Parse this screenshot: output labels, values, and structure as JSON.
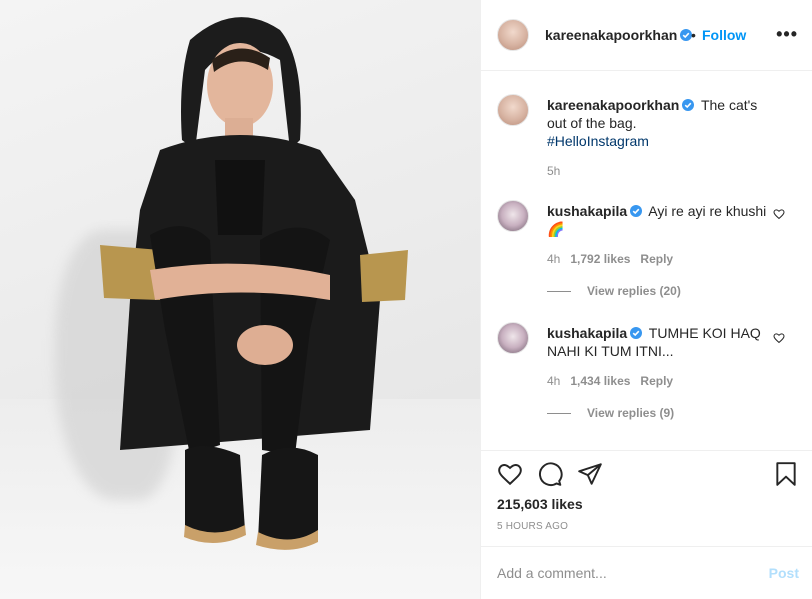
{
  "post": {
    "author": "kareenakapoorkhan",
    "separator": "•",
    "follow_label": "Follow",
    "more_label": "•••",
    "caption": "The cat's out of the bag.",
    "hashtag": "#HelloInstagram",
    "caption_age": "5h",
    "likes": "215,603 likes",
    "posted_ago": "5 HOURS AGO"
  },
  "comments": [
    {
      "user": "kushakapila",
      "text": "Ayi re ayi re khushi 🌈",
      "age": "4h",
      "likes": "1,792 likes",
      "reply_label": "Reply",
      "view_replies": "View replies (20)"
    },
    {
      "user": "kushakapila",
      "text": "TUMHE KOI HAQ NAHI KI TUM ITNI...",
      "age": "4h",
      "likes": "1,434 likes",
      "reply_label": "Reply",
      "view_replies": "View replies (9)"
    }
  ],
  "add_comment": {
    "placeholder": "Add a comment...",
    "post_label": "Post"
  },
  "icons": {
    "verified": "verified-badge-icon",
    "like": "heart-icon",
    "comment": "comment-bubble-icon",
    "share": "paper-plane-icon",
    "save": "bookmark-icon",
    "more": "more-options-icon"
  },
  "colors": {
    "accent": "#0095f6",
    "post_disabled": "#b2dffc",
    "muted": "#8e8e8e",
    "hashtag": "#00376b"
  }
}
